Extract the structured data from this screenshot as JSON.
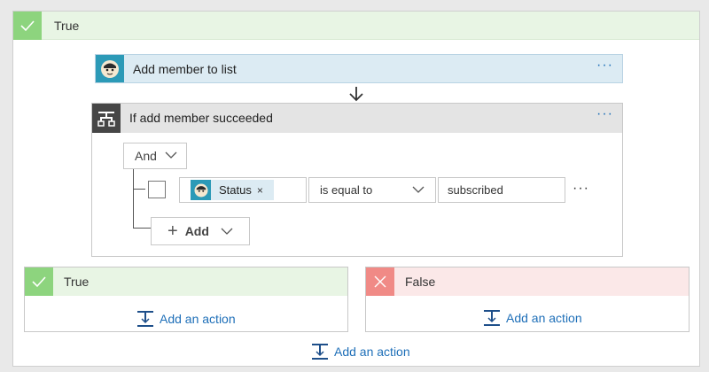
{
  "outer": {
    "title": "True"
  },
  "action_card": {
    "title": "Add member to list",
    "menu": "···"
  },
  "condition": {
    "title": "If add member succeeded",
    "menu": "···",
    "group_operator": "And",
    "row": {
      "token_label": "Status",
      "token_remove": "×",
      "operator": "is equal to",
      "value": "subscribed",
      "menu": "···"
    },
    "add_label": "Add"
  },
  "branches": {
    "true": {
      "title": "True",
      "add_action": "Add an action"
    },
    "false": {
      "title": "False",
      "add_action": "Add an action"
    }
  },
  "bottom_add_action": "Add an action",
  "colors": {
    "success": "#8dd47e",
    "failure": "#f08a86",
    "link": "#1e6fb8",
    "mailchimp": "#2c9ab7"
  },
  "icons": [
    "check-icon",
    "mailchimp-icon",
    "down-arrow-icon",
    "condition-icon",
    "chevron-down-icon",
    "plus-icon",
    "close-icon",
    "add-action-icon"
  ]
}
